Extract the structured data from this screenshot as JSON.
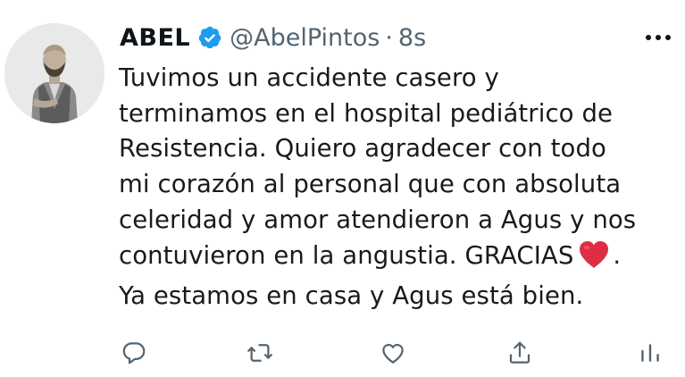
{
  "tweet": {
    "display_name": "ABEL",
    "handle": "@AbelPintos",
    "separator": "·",
    "time": "8s",
    "lines": [
      "Tuvimos un accidente casero y",
      "terminamos en el hospital pediátrico de",
      "Resistencia. Quiero agradecer con todo",
      "mi corazón al personal que con absoluta",
      "celeridad y amor atendieron a Agus y nos",
      "contuvieron en la angustia. GRACIAS",
      ".",
      "Ya estamos en casa y Agus está bien."
    ],
    "emoji": "red-heart",
    "verified_color": "#1d9bf0",
    "heart_color": "#dd2e44",
    "icon_color": "#536471"
  },
  "icons": {
    "reply": "reply-icon",
    "retweet": "retweet-icon",
    "like": "like-icon",
    "share": "share-icon",
    "views": "views-icon",
    "more": "more-icon"
  }
}
